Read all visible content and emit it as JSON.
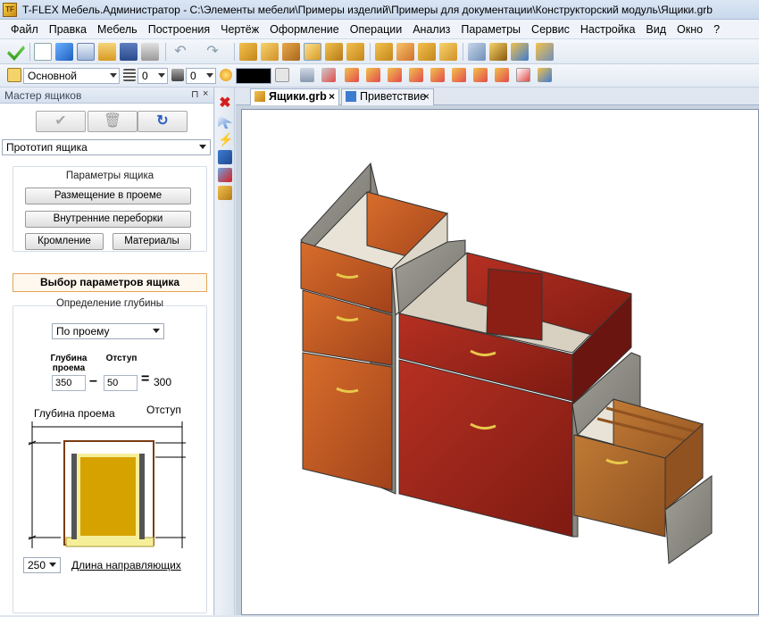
{
  "window": {
    "title": "T-FLEX Мебель.Администратор - C:\\Элементы мебели\\Примеры изделий\\Примеры для документации\\Конструкторский модуль\\Ящики.grb"
  },
  "menu": [
    "Файл",
    "Правка",
    "Мебель",
    "Построения",
    "Чертёж",
    "Оформление",
    "Операции",
    "Анализ",
    "Параметры",
    "Сервис",
    "Настройка",
    "Вид",
    "Окно",
    "?"
  ],
  "toolbar2": {
    "layer": "Основной",
    "field1": "0",
    "field2": "0",
    "field3": "0"
  },
  "panel": {
    "title": "Мастер ящиков",
    "prototype": "Прототип ящика",
    "group_title": "Параметры ящика",
    "btn_placement": "Размещение в проеме",
    "btn_partitions": "Внутренние переборки",
    "btn_edging": "Кромление",
    "btn_materials": "Материалы",
    "section_title": "Выбор параметров ящика",
    "depth_group_title": "Определение глубины",
    "depth_mode": "По проему",
    "label_opening_depth": "Глубина проема",
    "label_offset": "Отступ",
    "opening_depth": "350",
    "offset": "50",
    "result": "300",
    "diagram_label_depth": "Глубина проема",
    "diagram_label_offset": "Отступ",
    "guide_length_value": "250",
    "guide_length_label": "Длина направляющих"
  },
  "tabs": [
    {
      "label": "Ящики.grb",
      "active": true
    },
    {
      "label": "Приветствие",
      "active": false
    }
  ],
  "icons": {
    "pin": "pin-icon",
    "close": "close-icon",
    "ok": "checkmark-icon",
    "delete": "trash-icon",
    "refresh": "refresh-icon"
  },
  "colors": {
    "accent_orange": "#e4a55a",
    "wood_cherry": "#9c2318",
    "wood_orange": "#c2561f",
    "wood_light": "#b06a2a",
    "panel_grey": "#8f8e86"
  }
}
